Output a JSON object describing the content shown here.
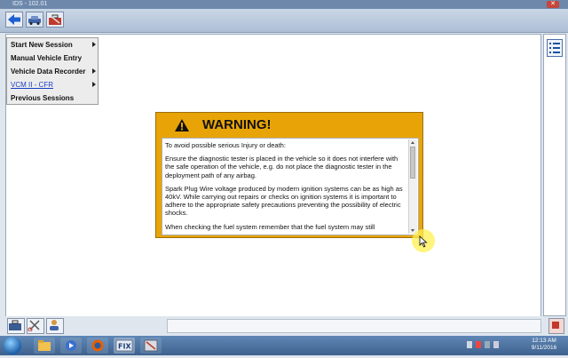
{
  "window": {
    "title": "IDS - 102.01"
  },
  "toolbar": {
    "buttons": [
      "back-arrow-icon",
      "vehicle-icon",
      "toolbox-icon"
    ]
  },
  "menu": {
    "items": [
      {
        "label": "Start New Session",
        "submenu": true,
        "style": "normal"
      },
      {
        "label": "Manual Vehicle Entry",
        "submenu": false,
        "style": "normal"
      },
      {
        "label": "Vehicle Data Recorder",
        "submenu": true,
        "style": "normal"
      },
      {
        "label": "VCM II - CFR",
        "submenu": true,
        "style": "link"
      },
      {
        "label": "Previous Sessions",
        "submenu": false,
        "style": "normal"
      }
    ]
  },
  "dialog": {
    "title": "WARNING!",
    "accent_color": "#e8a406",
    "paragraphs": [
      "To avoid possible serious Injury or death:",
      "Ensure the diagnostic tester is placed in the vehicle so it does not interfere with the safe operation of the vehicle, e.g. do not place the diagnostic tester in the deployment path of any airbag.",
      "Spark Plug Wire voltage produced by modern ignition systems can be as high as 40kV. While carrying out repairs or checks on ignition systems it is important to adhere to the appropriate safety precautions preventing the possibility of electric shocks.",
      "When checking the fuel system remember that the fuel system may still"
    ]
  },
  "right_panel": {
    "icon": "list-icon"
  },
  "bottom_bar": {
    "buttons": [
      "toolbox-icon",
      "scissors-tool-icon",
      "person-icon"
    ]
  },
  "taskbar": {
    "apps": [
      "folder-icon",
      "media-player-icon",
      "firefox-icon",
      "fix-icon",
      "screenshot-icon"
    ],
    "clock_time": "12:13 AM",
    "clock_date": "9/11/2016"
  }
}
